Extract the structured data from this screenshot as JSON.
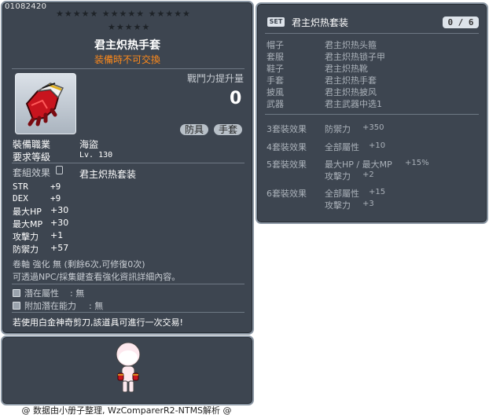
{
  "item": {
    "id": "01082420",
    "stars_row1": "★★★★★  ★★★★★  ★★★★★",
    "stars_row2": "★★★★★",
    "name": "君主炽热手套",
    "untradeable": "装備時不可交換",
    "power_label": "戰鬥力提升量",
    "power_value": "0",
    "tags": [
      "防具",
      "手套"
    ],
    "job_label": "裝備職業",
    "job_value": "海盜",
    "level_label": "要求等級",
    "level_value": "Lv. 130",
    "set_label": "套組效果",
    "set_name": "君主炽热套装",
    "stats": [
      {
        "label": "STR",
        "value": "+9"
      },
      {
        "label": "DEX",
        "value": "+9"
      },
      {
        "label": "最大HP",
        "value": "+30"
      },
      {
        "label": "最大MP",
        "value": "+30"
      },
      {
        "label": "攻擊力",
        "value": "+1"
      },
      {
        "label": "防禦力",
        "value": "+57"
      }
    ],
    "enhance_line": "卷軸 強化 無 (剩餘6次,可修復0次)",
    "enhance_hint": "可透過NPC/採集鍵查看強化資訊詳細內容。",
    "potential_label": "潛在屬性",
    "potential_value": "無",
    "addl_potential_label": "附加潛在能力",
    "addl_potential_value": "無",
    "trade_hint": "若使用白金神奇剪刀,該道具可進行一次交易!"
  },
  "set": {
    "badge": "SET",
    "title": "君主炽热套装",
    "counter": "0 / 6",
    "parts": [
      {
        "slot": "帽子",
        "name": "君主炽热头箍"
      },
      {
        "slot": "套服",
        "name": "君主炽热锁子甲"
      },
      {
        "slot": "鞋子",
        "name": "君主炽热靴"
      },
      {
        "slot": "手套",
        "name": "君主炽热手套"
      },
      {
        "slot": "披風",
        "name": "君主炽热披风"
      },
      {
        "slot": "武器",
        "name": "君主武器中选1"
      }
    ],
    "effects": [
      {
        "tier": "3套裝效果",
        "lines": [
          {
            "name": "防禦力",
            "value": "+350"
          }
        ]
      },
      {
        "tier": "4套裝效果",
        "lines": [
          {
            "name": "全部屬性",
            "value": "+10"
          }
        ]
      },
      {
        "tier": "5套裝效果",
        "lines": [
          {
            "name": "最大HP / 最大MP",
            "value": "+15%"
          },
          {
            "name": "攻擊力",
            "value": "+2"
          }
        ]
      },
      {
        "tier": "6套裝效果",
        "lines": [
          {
            "name": "全部屬性",
            "value": "+15"
          },
          {
            "name": "攻擊力",
            "value": "+3"
          }
        ]
      }
    ]
  },
  "footer": "@ 数据由小册子整理, WzComparerR2-NTMS解析 @",
  "colors": {
    "panel_bg": "#3d4550",
    "panel_border": "#8a96a3",
    "untradeable": "#ff8a1a",
    "tag_bg": "#b8c0c8"
  },
  "icons": [
    "glove-item-icon",
    "set-badge-icon",
    "potential-box-icon",
    "character-avatar"
  ]
}
